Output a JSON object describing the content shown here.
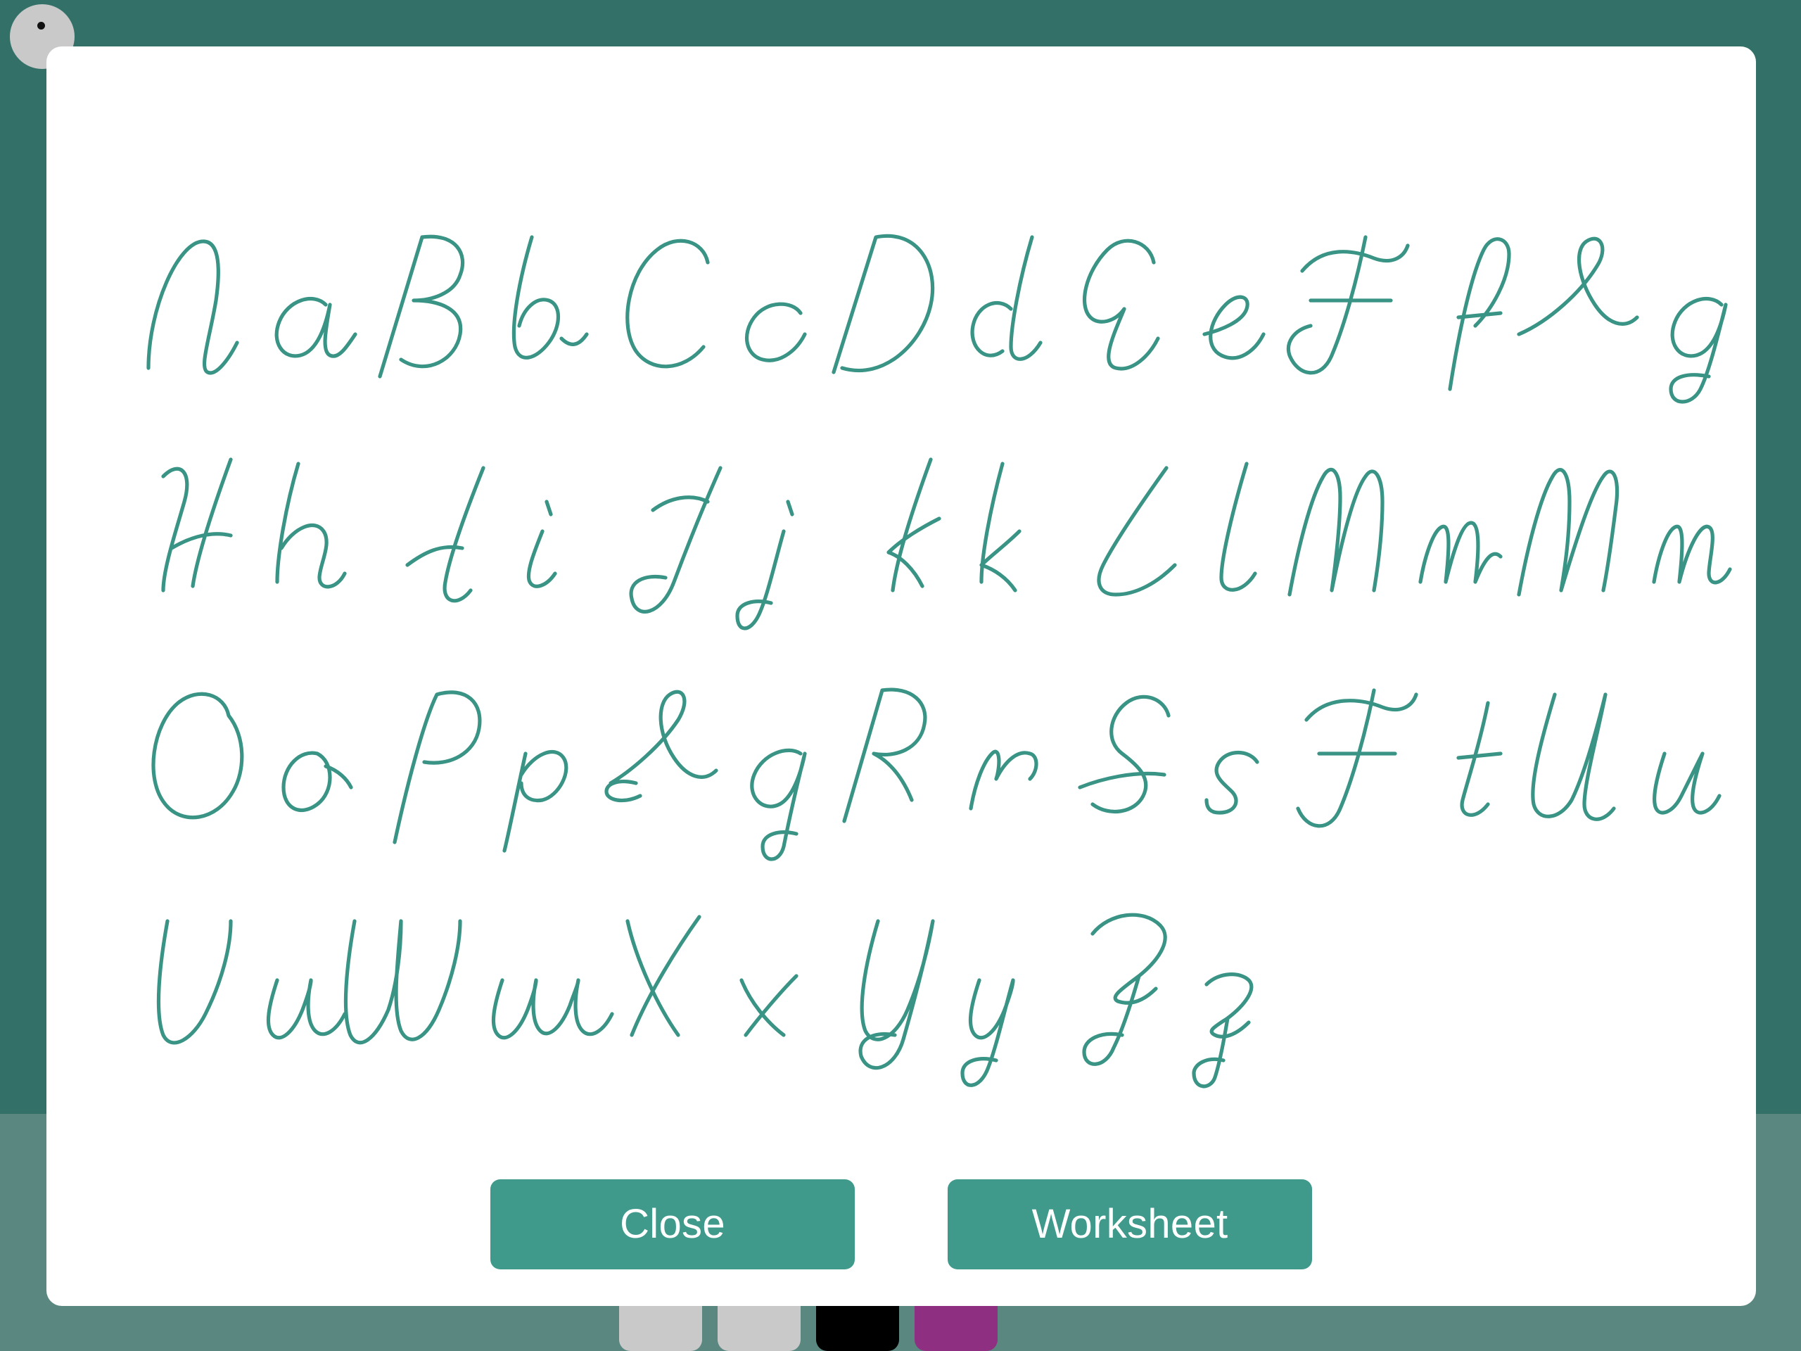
{
  "theme": {
    "background_teal": "#337068",
    "footer_teal": "#5a8880",
    "modal_background": "#ffffff",
    "letter_stroke": "#3a9486",
    "button_fill": "#3f9a8c",
    "button_text": "#ffffff"
  },
  "background_ui": {
    "tool_orb": {
      "name": "pen-tool-orb",
      "color": "#c9c9c9",
      "dot_color": "#111111"
    },
    "color_swatches": [
      {
        "name": "swatch-light-gray-1",
        "color": "#c9c9c9"
      },
      {
        "name": "swatch-light-gray-2",
        "color": "#c9c9c9"
      },
      {
        "name": "swatch-black",
        "color": "#000000"
      },
      {
        "name": "swatch-purple",
        "color": "#8e2f81"
      }
    ]
  },
  "modal": {
    "title": "",
    "alphabet_chart": {
      "script_style": "cursive",
      "pairs": [
        "Aa",
        "Bb",
        "Cc",
        "Dd",
        "Ee",
        "Ff",
        "Gg",
        "Hh",
        "Ii",
        "Jj",
        "Kk",
        "Ll",
        "Mm",
        "Nn",
        "Oo",
        "Pp",
        "Qq",
        "Rr",
        "Ss",
        "Tt",
        "Uu",
        "Vv",
        "Ww",
        "Xx",
        "Yy",
        "Zz"
      ],
      "rows": 4,
      "columns": 7
    },
    "actions": {
      "close_label": "Close",
      "worksheet_label": "Worksheet"
    }
  }
}
